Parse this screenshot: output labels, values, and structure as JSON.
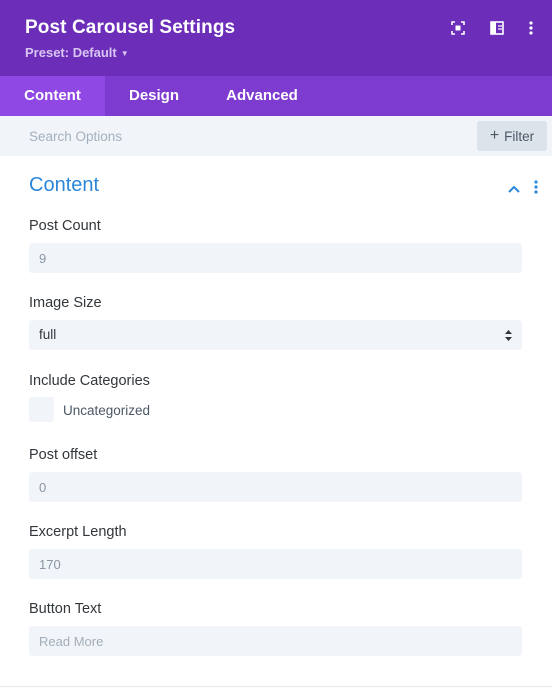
{
  "header": {
    "title": "Post Carousel Settings",
    "preset": "Preset: Default",
    "icons": [
      "expand-icon",
      "split-view-icon",
      "more-vertical-icon"
    ]
  },
  "tabs": [
    {
      "label": "Content",
      "active": true
    },
    {
      "label": "Design",
      "active": false
    },
    {
      "label": "Advanced",
      "active": false
    }
  ],
  "search": {
    "placeholder": "Search Options",
    "filter_label": "Filter"
  },
  "section": {
    "title": "Content",
    "expanded": true
  },
  "fields": {
    "post_count": {
      "label": "Post Count",
      "value": "9"
    },
    "image_size": {
      "label": "Image Size",
      "value": "full"
    },
    "include_categories": {
      "label": "Include Categories",
      "option": "Uncategorized",
      "checked": false
    },
    "post_offset": {
      "label": "Post offset",
      "value": "0"
    },
    "excerpt_length": {
      "label": "Excerpt Length",
      "value": "170"
    },
    "button_text": {
      "label": "Button Text",
      "placeholder": "Read More"
    }
  },
  "colors": {
    "header_bg": "#6c2eb9",
    "tabs_bg": "#7e3bd0",
    "tab_active_bg": "#8f48e3",
    "section_title": "#2b87da",
    "field_bg": "#f1f5f9"
  }
}
